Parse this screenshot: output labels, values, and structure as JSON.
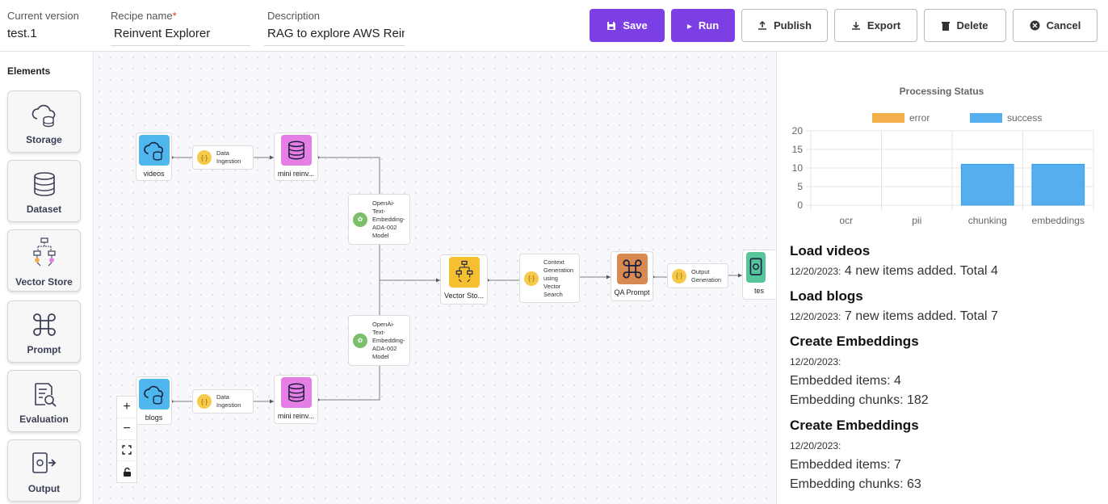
{
  "header": {
    "version_label": "Current version",
    "version_value": "test.1",
    "name_label": "Recipe name",
    "name_required": "*",
    "name_value": "Reinvent Explorer",
    "desc_label": "Description",
    "desc_value": "RAG to explore AWS Rein",
    "buttons": {
      "save": "Save",
      "run": "Run",
      "publish": "Publish",
      "export": "Export",
      "delete": "Delete",
      "cancel": "Cancel"
    }
  },
  "sidebar": {
    "title": "Elements",
    "items": [
      {
        "label": "Storage",
        "icon": "cloud-database-icon"
      },
      {
        "label": "Dataset",
        "icon": "database-icon"
      },
      {
        "label": "Vector Store",
        "icon": "vector-store-icon"
      },
      {
        "label": "Prompt",
        "icon": "command-icon"
      },
      {
        "label": "Evaluation",
        "icon": "evaluation-icon"
      },
      {
        "label": "Output",
        "icon": "output-icon"
      }
    ]
  },
  "canvas": {
    "nodes": {
      "videos": "videos",
      "blogs": "blogs",
      "mini_top": "mini reinv...",
      "mini_bottom": "mini reinv...",
      "vector_store": "Vector Sto...",
      "qa_prompt": "QA Prompt",
      "output": "tes"
    },
    "processes": {
      "ingest_top": [
        "Data",
        "Ingestion"
      ],
      "ingest_bottom": [
        "Data",
        "Ingestion"
      ],
      "embed_top": [
        "OpenAi-",
        "Text-",
        "Embedding-",
        "ADA-002",
        "Model"
      ],
      "embed_bottom": [
        "OpenAi-",
        "Text-",
        "Embedding-",
        "ADA-002",
        "Model"
      ],
      "context": [
        "Context",
        "Generation",
        "using",
        "Vector",
        "Search"
      ],
      "outgen": [
        "Output",
        "Generation"
      ]
    },
    "zoom": {
      "plus": "+",
      "minus": "−"
    }
  },
  "chart_data": {
    "type": "bar",
    "title": "Processing Status",
    "categories": [
      "ocr",
      "pii",
      "chunking",
      "embeddings"
    ],
    "series": [
      {
        "name": "error",
        "values": [
          0,
          0,
          0,
          0
        ],
        "color": "#f5b04e"
      },
      {
        "name": "success",
        "values": [
          0,
          0,
          11,
          11
        ],
        "color": "#55aeee"
      }
    ],
    "ylim": [
      0,
      20
    ],
    "yticks": [
      0,
      5,
      10,
      15,
      20
    ],
    "grid": true,
    "legend": "top",
    "stacked": true
  },
  "logs": [
    {
      "title": "Load videos",
      "ts": "12/20/2023:",
      "text": "4 new items added. Total 4"
    },
    {
      "title": "Load blogs",
      "ts": "12/20/2023:",
      "text": "7 new items added. Total 7"
    },
    {
      "title": "Create Embeddings",
      "ts": "12/20/2023:",
      "lines": [
        "Embedded items: 4",
        "Embedding chunks: 182"
      ]
    },
    {
      "title": "Create Embeddings",
      "ts": "12/20/2023:",
      "lines": [
        "Embedded items: 7",
        "Embedding chunks: 63"
      ]
    }
  ],
  "colors": {
    "accent": "#7b3fe4",
    "storage_node": "#4fb6ee",
    "dataset_node": "#e77ee6",
    "vector_node": "#f6c030",
    "prompt_node": "#d88a52",
    "output_node": "#58c59a"
  }
}
